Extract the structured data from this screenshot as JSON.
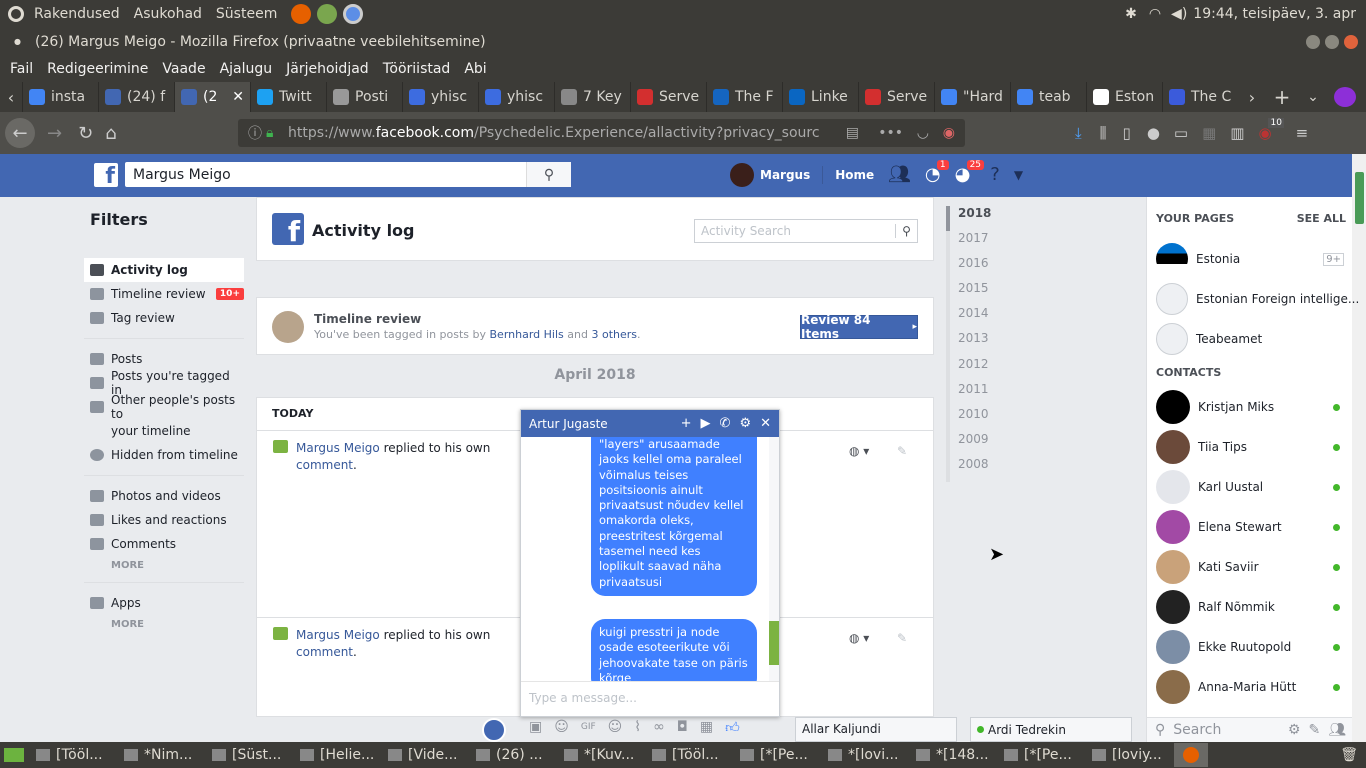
{
  "system_bar": {
    "menu": [
      "Rakendused",
      "Asukohad",
      "Süsteem"
    ],
    "clock": "19:44, teisipäev, 3. apr"
  },
  "window": {
    "title": "(26) Margus Meigo - Mozilla Firefox (privaatne veebilehitsemine)"
  },
  "firefox_menu": [
    "Fail",
    "Redigeerimine",
    "Vaade",
    "Ajalugu",
    "Järjehoidjad",
    "Tööriistad",
    "Abi"
  ],
  "tabs": [
    {
      "label": "insta",
      "color": "#4285f4"
    },
    {
      "label": "(24) f",
      "color": "#4267b2"
    },
    {
      "label": "(2",
      "color": "#4267b2"
    },
    {
      "label": "Twitt",
      "color": "#1da1f2"
    },
    {
      "label": "Posti",
      "color": "#999999"
    },
    {
      "label": "yhisc",
      "color": "#3d6ce0"
    },
    {
      "label": "yhisc",
      "color": "#3d6ce0"
    },
    {
      "label": "7 Key",
      "color": "#888888"
    },
    {
      "label": "Serve",
      "color": "#d32f2f"
    },
    {
      "label": "The F",
      "color": "#1565c0"
    },
    {
      "label": "Linke",
      "color": "#0a66c2"
    },
    {
      "label": "Serve",
      "color": "#d32f2f"
    },
    {
      "label": "\"Hard",
      "color": "#4285f4"
    },
    {
      "label": "teab",
      "color": "#4285f4"
    },
    {
      "label": "Eston",
      "color": "#ffffff"
    },
    {
      "label": "The C",
      "color": "#3b5bdb"
    }
  ],
  "url": {
    "prefix": "https://www.",
    "domain": "facebook.com",
    "path": "/Psychedelic.Experience/allactivity?privacy_sourc"
  },
  "downloads_badge": "10",
  "fb": {
    "search_value": "Margus Meigo",
    "user": "Margus",
    "home": "Home",
    "messages_badge": "1",
    "notifications_badge": "25"
  },
  "filters": {
    "title": "Filters",
    "group1": [
      "Activity log",
      "Timeline review",
      "Tag review"
    ],
    "timeline_badge": "10+",
    "group2": [
      "Posts",
      "Posts you're tagged in",
      "Other people's posts to",
      "your timeline",
      "Hidden from timeline"
    ],
    "group3": [
      "Photos and videos",
      "Likes and reactions",
      "Comments"
    ],
    "more": "MORE",
    "group4": [
      "Apps"
    ]
  },
  "activity": {
    "title": "Activity log",
    "search_placeholder": "Activity Search",
    "review_title": "Timeline review",
    "review_text_pre": "You've been tagged in posts by ",
    "review_name": "Bernhard Hils",
    "review_and": " and ",
    "review_others": "3 others",
    "review_dot": ".",
    "review_button": "Review 84 Items",
    "month": "April 2018",
    "today": "TODAY",
    "entries": [
      {
        "name": "Margus Meigo",
        "text": " replied to his own",
        "link": "comment",
        "dot": "."
      },
      {
        "name": "Margus Meigo",
        "text": " replied to his own",
        "link": "comment",
        "dot": "."
      }
    ]
  },
  "years": [
    "2018",
    "2017",
    "2016",
    "2015",
    "2014",
    "2013",
    "2012",
    "2011",
    "2010",
    "2009",
    "2008"
  ],
  "right": {
    "pages_head": "YOUR PAGES",
    "see_all": "SEE ALL",
    "pages": [
      {
        "name": "Estonia",
        "badge": "9+"
      },
      {
        "name": "Estonian Foreign intellige..."
      },
      {
        "name": "Teabeamet"
      }
    ],
    "contacts_head": "CONTACTS",
    "contacts": [
      "Kristjan Miks",
      "Tiia Tips",
      "Karl Uustal",
      "Elena Stewart",
      "Kati Saviir",
      "Ralf Nõmmik",
      "Ekke Ruutopold",
      "Anna-Maria Hütt"
    ],
    "search_placeholder": "Search"
  },
  "chat": {
    "name": "Artur Jugaste",
    "msg1": "\"layers\" arusaamade jaoks kellel oma paraleel võimalus teises positsioonis ainult privaatsust nõudev kellel omakorda oleks, preestritest kõrgemal tasemel need kes loplikult saavad näha privaatsusi",
    "msg2": "kuigi presstri ja node osade esoteerikute või jehoovakate tase on päris kõrge",
    "input_placeholder": "Type a message..."
  },
  "minichats": [
    "Allar Kaljundi",
    "Ardi Tedrekin"
  ],
  "taskbar": [
    "[Tööl...",
    "*Nim...",
    "[Süst...",
    "[Helie...",
    "[Vide...",
    "(26) ...",
    "*[Kuv...",
    "[Tööl...",
    "[*[Pe...",
    "*[lovi...",
    "*[148...",
    "[*[Pe...",
    "[loviy..."
  ]
}
